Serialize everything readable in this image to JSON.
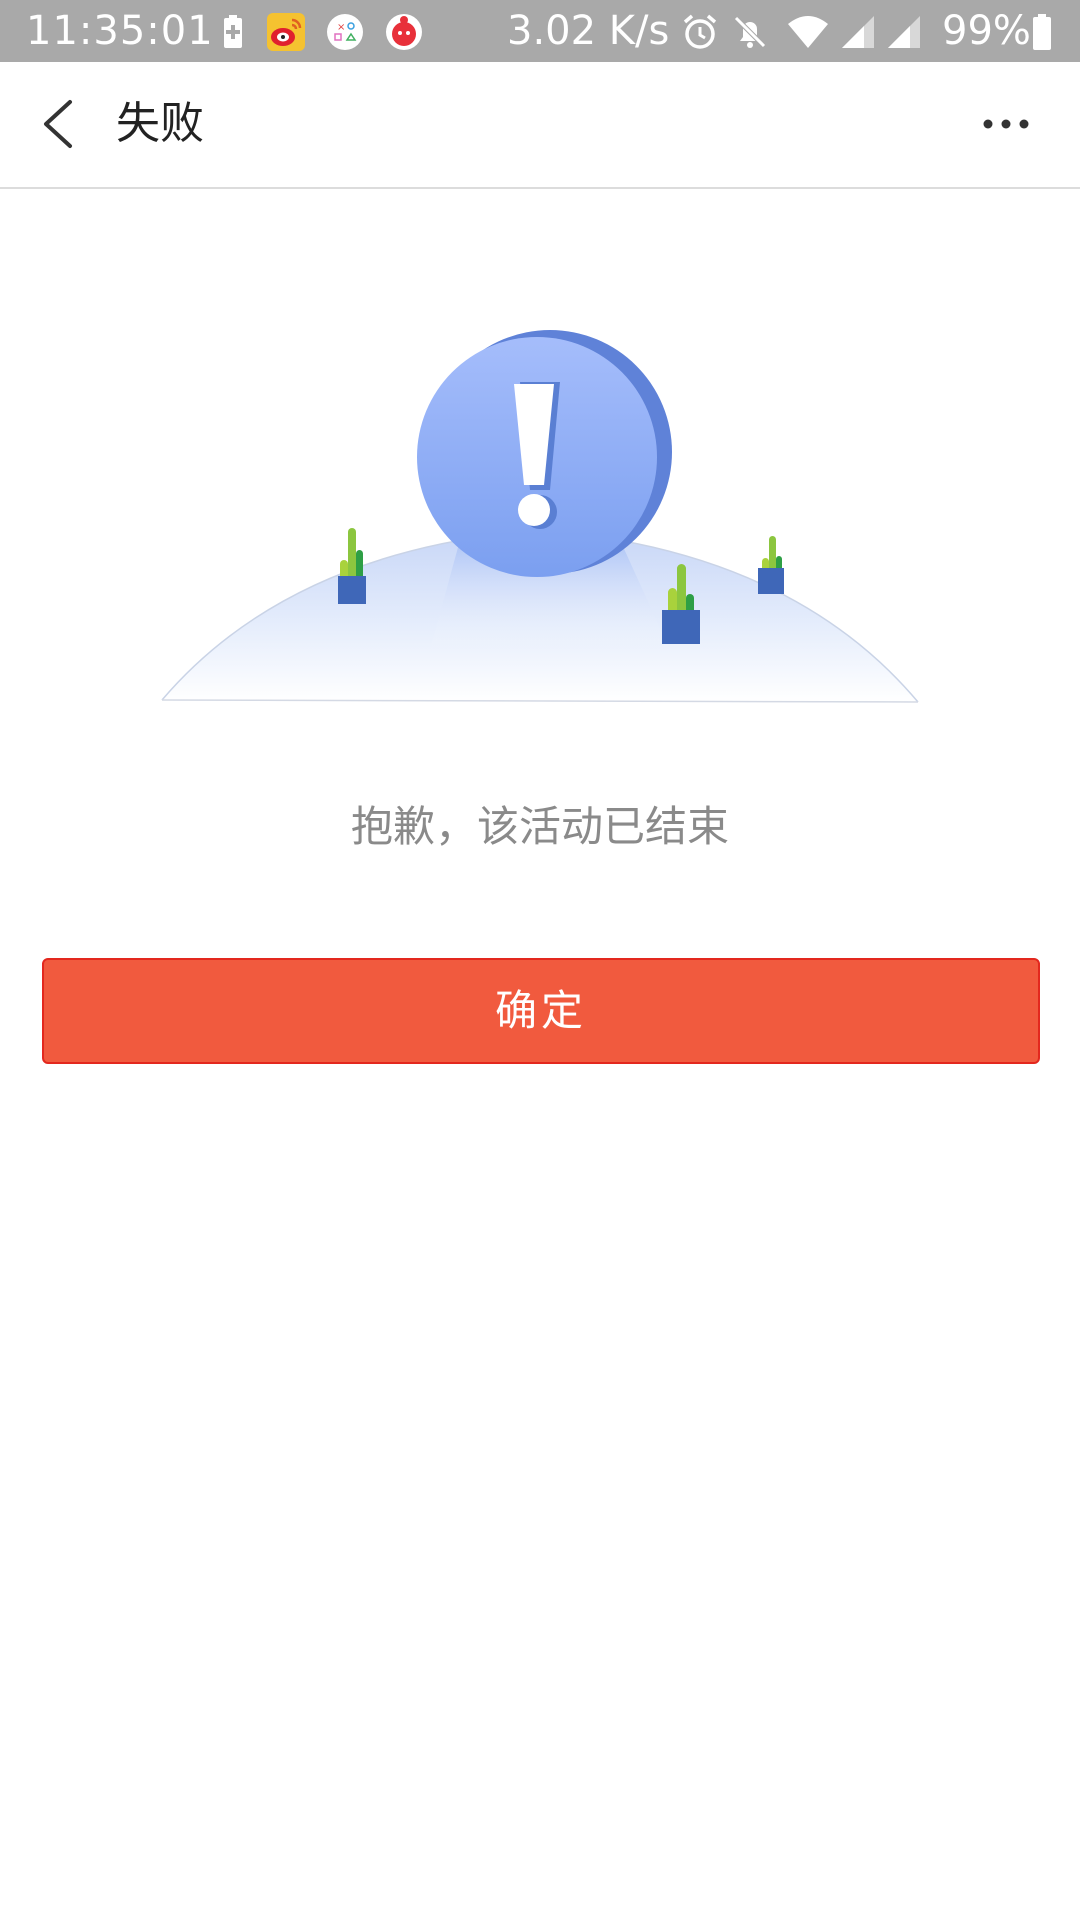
{
  "status_bar": {
    "time": "11:35:01",
    "network_speed": "3.02 K/s",
    "battery_percent": "99%",
    "notification_icons": [
      "battery-saver-icon",
      "weibo-icon",
      "game-controller-icon",
      "red-app-icon"
    ],
    "system_icons": [
      "alarm-icon",
      "mute-bell-icon",
      "wifi-icon",
      "signal-icon",
      "signal-icon",
      "battery-icon"
    ]
  },
  "header": {
    "title": "失败",
    "back_icon": "chevron-left-icon",
    "more_icon": "more-horizontal-icon"
  },
  "illustration": {
    "icon": "exclamation-icon",
    "accent_color": "#7e9ff0"
  },
  "content": {
    "message": "抱歉，该活动已结束",
    "confirm_label": "确定"
  },
  "colors": {
    "status_bar": "#a9a9a9",
    "button": "#f15a3e",
    "button_border": "#e3281e",
    "message_text": "#8a8a8a"
  }
}
